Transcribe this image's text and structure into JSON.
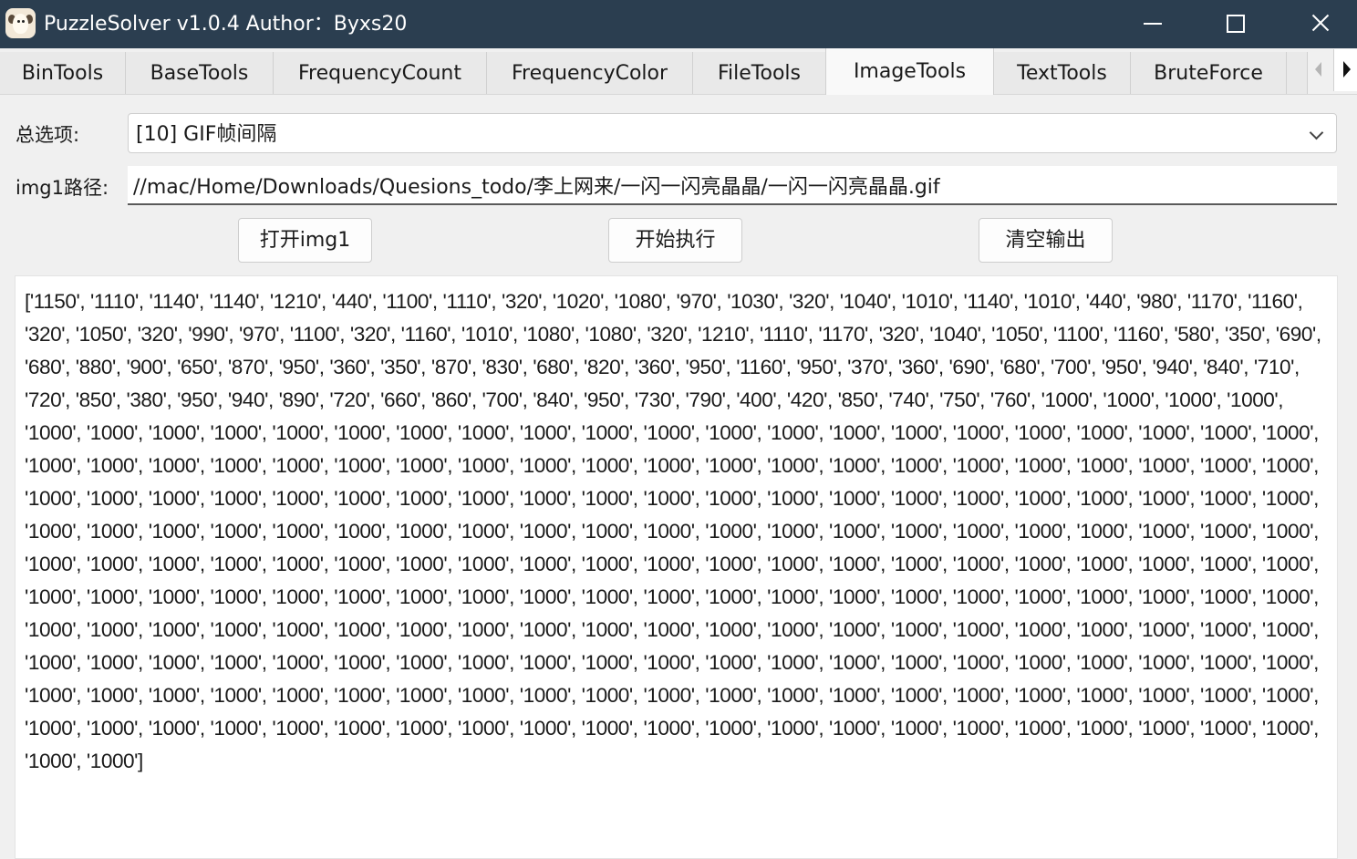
{
  "window": {
    "title": "PuzzleSolver v1.0.4  Author：Byxs20",
    "icon": "sheep-app-icon"
  },
  "tabs": [
    {
      "label": "BinTools",
      "active": false
    },
    {
      "label": "BaseTools",
      "active": false
    },
    {
      "label": "FrequencyCount",
      "active": false
    },
    {
      "label": "FrequencyColor",
      "active": false
    },
    {
      "label": "FileTools",
      "active": false
    },
    {
      "label": "ImageTools",
      "active": true
    },
    {
      "label": "TextTools",
      "active": false
    },
    {
      "label": "BruteForce",
      "active": false
    }
  ],
  "form": {
    "option_label": "总选项:",
    "option_value": "[10] GIF帧间隔",
    "img1_label": "img1路径:",
    "img1_value": "//mac/Home/Downloads/Quesions_todo/李上网来/一闪一闪亮晶晶/一闪一闪亮晶晶.gif"
  },
  "buttons": {
    "open": "打开img1",
    "run": "开始执行",
    "clear": "清空输出"
  },
  "output": {
    "text": "['1150', '1110', '1140', '1140', '1210', '440', '1100', '1110', '320', '1020', '1080', '970', '1030', '320', '1040', '1010', '1140', '1010', '440', '980', '1170', '1160', '320', '1050', '320', '990', '970', '1100', '320', '1160', '1010', '1080', '1080', '320', '1210', '1110', '1170', '320', '1040', '1050', '1100', '1160', '580', '350', '690', '680', '880', '900', '650', '870', '950', '360', '350', '870', '830', '680', '820', '360', '950', '1160', '950', '370', '360', '690', '680', '700', '950', '940', '840', '710', '720', '850', '380', '950', '940', '890', '720', '660', '860', '700', '840', '950', '730', '790', '400', '420', '850', '740', '750', '760', '1000', '1000', '1000', '1000', '1000', '1000', '1000', '1000', '1000', '1000', '1000', '1000', '1000', '1000', '1000', '1000', '1000', '1000', '1000', '1000', '1000', '1000', '1000', '1000', '1000', '1000', '1000', '1000', '1000', '1000', '1000', '1000', '1000', '1000', '1000', '1000', '1000', '1000', '1000', '1000', '1000', '1000', '1000', '1000', '1000', '1000', '1000', '1000', '1000', '1000', '1000', '1000', '1000', '1000', '1000', '1000', '1000', '1000', '1000', '1000', '1000', '1000', '1000', '1000', '1000', '1000', '1000', '1000', '1000', '1000', '1000', '1000', '1000', '1000', '1000', '1000', '1000', '1000', '1000', '1000', '1000', '1000', '1000', '1000', '1000', '1000', '1000', '1000', '1000', '1000', '1000', '1000', '1000', '1000', '1000', '1000', '1000', '1000', '1000', '1000', '1000', '1000', '1000', '1000', '1000', '1000', '1000', '1000', '1000', '1000', '1000', '1000', '1000', '1000', '1000', '1000', '1000', '1000', '1000', '1000', '1000', '1000', '1000', '1000', '1000', '1000', '1000', '1000', '1000', '1000', '1000', '1000', '1000', '1000', '1000', '1000', '1000', '1000', '1000', '1000', '1000', '1000', '1000', '1000', '1000', '1000', '1000', '1000', '1000', '1000', '1000', '1000', '1000', '1000', '1000', '1000', '1000', '1000', '1000', '1000', '1000', '1000', '1000', '1000', '1000', '1000', '1000', '1000', '1000', '1000', '1000', '1000', '1000', '1000', '1000', '1000', '1000', '1000', '1000', '1000', '1000', '1000', '1000', '1000', '1000', '1000', '1000', '1000', '1000', '1000', '1000', '1000', '1000', '1000', '1000', '1000', '1000', '1000', '1000', '1000', '1000', '1000', '1000', '1000', '1000', '1000', '1000', '1000', '1000', '1000', '1000', '1000', '1000', '1000', '1000', '1000']"
  },
  "colors": {
    "titlebar": "#2b3e50",
    "background": "#f0f0f0",
    "tab_active": "#f9f9f9",
    "tab_inactive": "#e9e9e9"
  }
}
